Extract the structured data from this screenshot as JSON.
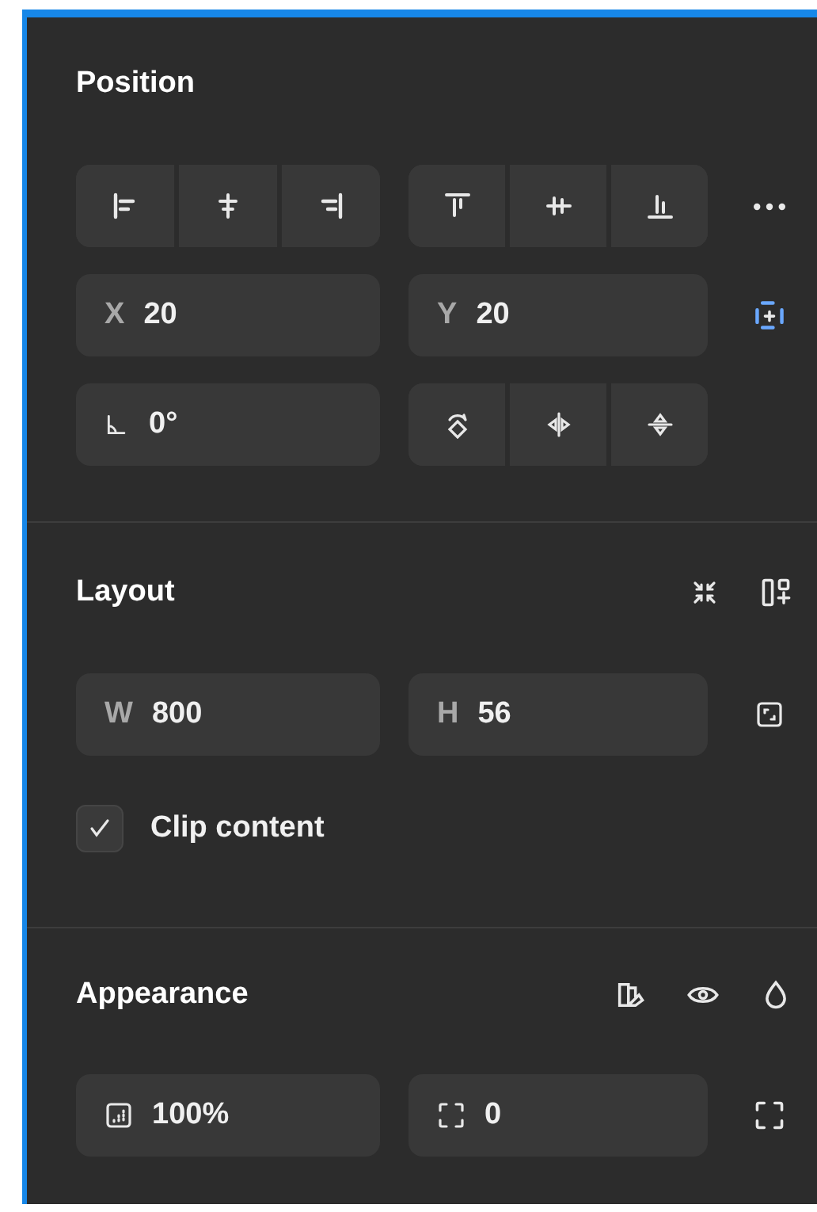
{
  "sections": [
    {
      "title": "Position",
      "fields": [
        {
          "kind": "letter",
          "label": "X",
          "value": "20"
        },
        {
          "kind": "letter",
          "label": "Y",
          "value": "20"
        },
        {
          "kind": "icon",
          "value": "0°"
        }
      ]
    },
    {
      "title": "Layout",
      "fields": [
        {
          "kind": "letter",
          "label": "W",
          "value": "800"
        },
        {
          "kind": "letter",
          "label": "H",
          "value": "56"
        }
      ],
      "checkbox": {
        "label": "Clip content",
        "checked": true
      }
    },
    {
      "title": "Appearance",
      "fields": [
        {
          "kind": "icon",
          "value": "100%"
        },
        {
          "kind": "icon",
          "value": "0"
        }
      ]
    }
  ]
}
